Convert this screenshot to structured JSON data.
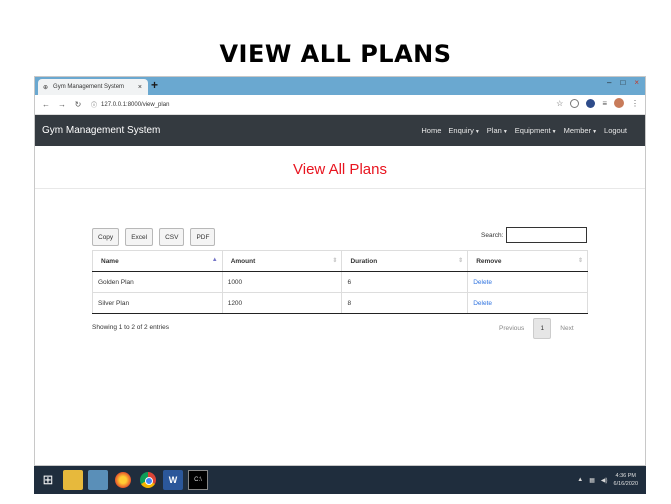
{
  "slide": {
    "title": "VIEW ALL PLANS"
  },
  "browser": {
    "tab_title": "Gym Management System",
    "tab_close": "×",
    "new_tab": "+",
    "url": "127.0.0.1:8000/view_plan",
    "window_controls": [
      "–",
      "□",
      "×"
    ]
  },
  "navbar": {
    "brand": "Gym Management System",
    "items": [
      "Home",
      "Enquiry",
      "Plan",
      "Equipment",
      "Member",
      "Logout"
    ],
    "dropdown_items": [
      "Enquiry",
      "Plan",
      "Equipment",
      "Member"
    ]
  },
  "page": {
    "heading": "View All Plans",
    "heading_color": "#e8141f"
  },
  "toolbar": {
    "buttons": [
      "Copy",
      "Excel",
      "CSV",
      "PDF"
    ],
    "search_label": "Search:",
    "search_value": ""
  },
  "table": {
    "columns": [
      "Name",
      "Amount",
      "Duration",
      "Remove"
    ],
    "sorted_column": "Name",
    "rows": [
      {
        "name": "Golden Plan",
        "amount": "1000",
        "duration": "6",
        "remove": "Delete"
      },
      {
        "name": "Silver Plan",
        "amount": "1200",
        "duration": "8",
        "remove": "Delete"
      }
    ]
  },
  "footer": {
    "info": "Showing 1 to 2 of 2 entries",
    "previous": "Previous",
    "page": "1",
    "next": "Next"
  },
  "taskbar": {
    "time": "4:36 PM",
    "date": "6/16/2020",
    "icons": [
      "windows-start-icon",
      "folder-icon",
      "app-icon",
      "firefox-icon",
      "chrome-icon",
      "word-icon",
      "terminal-icon"
    ]
  }
}
